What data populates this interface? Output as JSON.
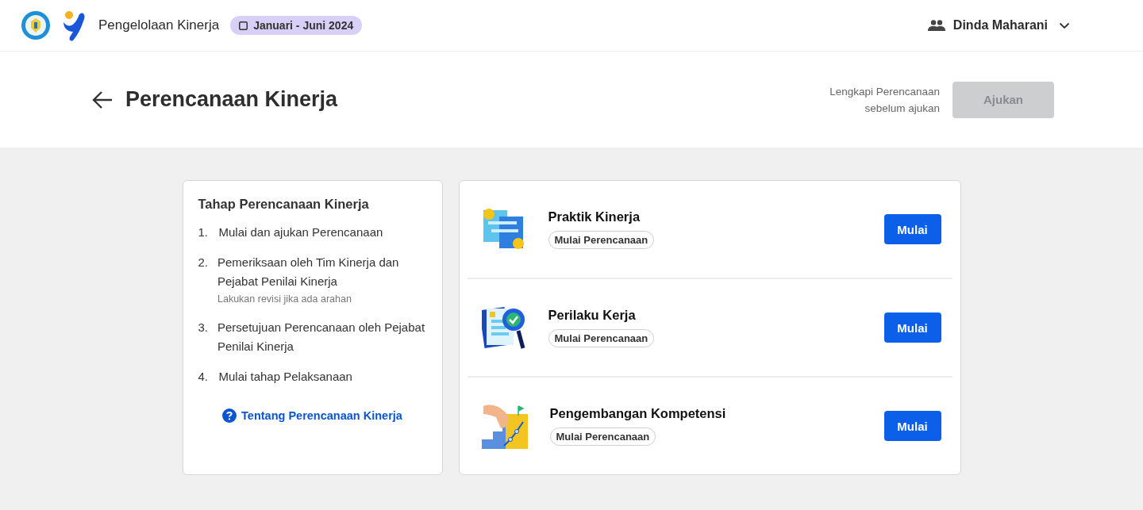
{
  "header": {
    "app_title": "Pengelolaan Kinerja",
    "period": "Januari - Juni 2024",
    "user_name": "Dinda Maharani"
  },
  "page": {
    "title": "Perencanaan Kinerja",
    "hint": "Lengkapi Perencanaan sebelum ajukan",
    "submit_button": {
      "label": "Ajukan",
      "disabled": true
    }
  },
  "steps_card": {
    "title": "Tahap Perencanaan Kinerja",
    "steps": [
      {
        "number": "1.",
        "text": "Mulai dan ajukan Perencanaan"
      },
      {
        "number": "2.",
        "text": "Pemeriksaan oleh Tim Kinerja dan Pejabat Penilai Kinerja",
        "note": "Lakukan revisi jika ada arahan"
      },
      {
        "number": "3.",
        "text": "Persetujuan Perencanaan oleh Pejabat Penilai Kinerja"
      },
      {
        "number": "4.",
        "text": "Mulai tahap Pelaksanaan"
      }
    ],
    "link": "Tentang Perencanaan Kinerja"
  },
  "sections": [
    {
      "kind": "practice",
      "title": "Praktik Kinerja",
      "status": "Mulai Perencanaan",
      "button": "Mulai"
    },
    {
      "kind": "behavior",
      "title": "Perilaku Kerja",
      "status": "Mulai Perencanaan",
      "button": "Mulai"
    },
    {
      "kind": "competency",
      "title": "Pengembangan Kompetensi",
      "status": "Mulai Perencanaan",
      "button": "Mulai"
    }
  ]
}
